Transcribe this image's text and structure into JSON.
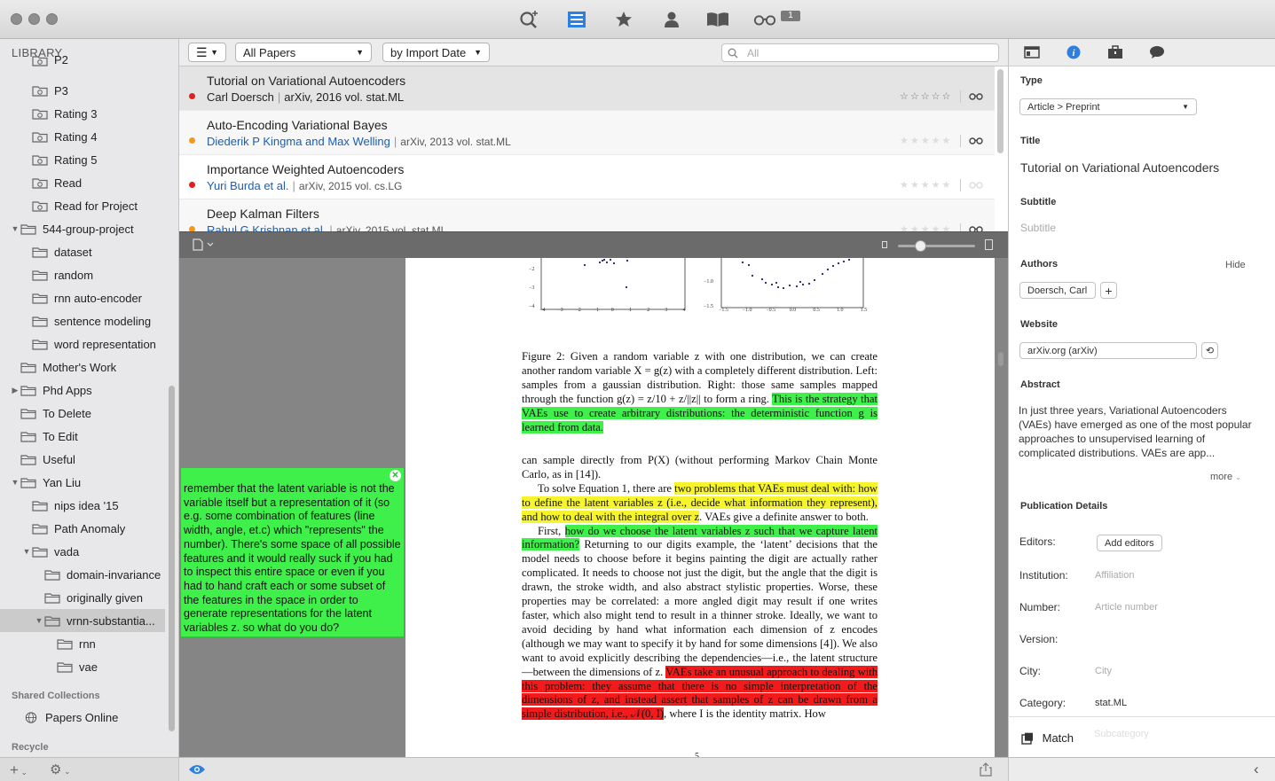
{
  "toolbar": {
    "icons": [
      "add-search-icon",
      "library-icon",
      "star-icon",
      "person-icon",
      "book-icon",
      "glasses-icon"
    ],
    "glasses_badge": "1"
  },
  "sidebar": {
    "header": "LIBRARY",
    "items": [
      {
        "label": "P2",
        "type": "smart",
        "level": 1
      },
      {
        "label": "P3",
        "type": "smart",
        "level": 1
      },
      {
        "label": "Rating 3",
        "type": "smart",
        "level": 1
      },
      {
        "label": "Rating 4",
        "type": "smart",
        "level": 1
      },
      {
        "label": "Rating 5",
        "type": "smart",
        "level": 1
      },
      {
        "label": "Read",
        "type": "smart",
        "level": 1
      },
      {
        "label": "Read for Project",
        "type": "smart",
        "level": 1
      },
      {
        "label": "544-group-project",
        "type": "folder",
        "level": 0,
        "expanded": true
      },
      {
        "label": "dataset",
        "type": "folder",
        "level": 1
      },
      {
        "label": "random",
        "type": "folder",
        "level": 1
      },
      {
        "label": "rnn auto-encoder",
        "type": "folder",
        "level": 1
      },
      {
        "label": "sentence modeling",
        "type": "folder",
        "level": 1
      },
      {
        "label": "word representation",
        "type": "folder",
        "level": 1
      },
      {
        "label": "Mother's Work",
        "type": "folder",
        "level": 0
      },
      {
        "label": "Phd Apps",
        "type": "folder",
        "level": 0,
        "collapsed": true
      },
      {
        "label": "To Delete",
        "type": "folder",
        "level": 0
      },
      {
        "label": "To Edit",
        "type": "folder",
        "level": 0
      },
      {
        "label": "Useful",
        "type": "folder",
        "level": 0
      },
      {
        "label": "Yan Liu",
        "type": "folder",
        "level": 0,
        "expanded": true
      },
      {
        "label": "nips idea '15",
        "type": "folder",
        "level": 1
      },
      {
        "label": "Path Anomaly",
        "type": "folder",
        "level": 1
      },
      {
        "label": "vada",
        "type": "folder",
        "level": 1,
        "expanded": true
      },
      {
        "label": "domain-invariance",
        "type": "folder",
        "level": 2
      },
      {
        "label": "originally given",
        "type": "folder",
        "level": 2
      },
      {
        "label": "vrnn-substantia...",
        "type": "folder",
        "level": 2,
        "expanded": true,
        "selected": true
      },
      {
        "label": "rnn",
        "type": "folder",
        "level": 3
      },
      {
        "label": "vae",
        "type": "folder",
        "level": 3
      }
    ],
    "shared_title": "Shared Collections",
    "shared_items": [
      {
        "label": "Papers Online"
      }
    ],
    "recycle_title": "Recycle"
  },
  "list_toolbar": {
    "filter": "All Papers",
    "sort": "by Import Date",
    "search_placeholder": "All"
  },
  "papers": [
    {
      "title": "Tutorial on Variational Autoencoders",
      "authors": "Carl Doersch",
      "source": "arXiv, 2016 vol. stat.ML",
      "dot": "#e0201e",
      "stars": "☆☆☆☆☆"
    },
    {
      "title": "Auto-Encoding Variational Bayes",
      "authors": "Diederik P Kingma and Max Welling",
      "source": "arXiv, 2013 vol. stat.ML",
      "dot": "#f29a1f",
      "stars": "★★★★★"
    },
    {
      "title": "Importance Weighted Autoencoders",
      "authors": "Yuri Burda et al.",
      "source": "arXiv, 2015 vol. cs.LG",
      "dot": "#e0201e",
      "stars": "★★★★★"
    },
    {
      "title": "Deep Kalman Filters",
      "authors": "Rahul G Krishnan et al.",
      "source": "arXiv, 2015 vol. stat.ML",
      "dot": "#f29a1f",
      "stars": "★★★★★"
    }
  ],
  "note": {
    "text": "remember that the latent variable is not the variable itself but a representation of it (so e.g. some combination of features (line width, angle, et.c) which \"represents\" the number). There's some space of all possible features and it would really suck if you had to inspect this entire space or even if you had to hand craft each or some subset of the features in the space in order to generate representations for the latent variables z. so what do you do?"
  },
  "pdf": {
    "plot_left_yticks": [
      "−2",
      "−3",
      "−4"
    ],
    "plot_left_xticks": [
      "−4",
      "−3",
      "−2",
      "−1",
      "0",
      "1",
      "2",
      "3",
      "4"
    ],
    "plot_right_yticks": [
      "−1.0",
      "−1.5"
    ],
    "plot_right_xticks": [
      "−1.5",
      "−1.0",
      "−0.5",
      "0.0",
      "0.5",
      "1.0",
      "1.5"
    ],
    "caption_plain": "Figure 2: Given a random variable z with one distribution, we can create another random variable X = g(z) with a completely different distribution. Left: samples from a gaussian distribution. Right: those same samples mapped through the function g(z) = z/10 + z/||z|| to form a ring.",
    "caption_hl": "This is the strategy that VAEs use to create arbitrary distributions: the deterministic function g is learned from data.",
    "p1": "can sample directly from P(X) (without performing Markov Chain Monte Carlo, as in [14]).",
    "p2_a": "To solve Equation 1, there are",
    "p2_hl": "two problems that VAEs must deal with: how to define the latent variables z (i.e., decide what information they represent), and how to deal with the integral over z",
    "p2_b": ". VAEs give a definite answer to both.",
    "p3_a": "First,",
    "p3_hl": "how do we choose the latent variables z such that we capture latent information?",
    "p3_b": "Returning to our digits example, the ‘latent’ decisions that the model needs to choose before it begins painting the digit are actually rather complicated. It needs to choose not just the digit, but the angle that the digit is drawn, the stroke width, and also abstract stylistic properties. Worse, these properties may be correlated: a more angled digit may result if one writes faster, which also might tend to result in a thinner stroke. Ideally, we want to avoid deciding by hand what information each dimension of z encodes (although we may want to specify it by hand for some dimensions [4]). We also want to avoid explicitly describing the dependencies—i.e., the latent structure—between the dimensions of z.",
    "p3_hl2": "VAEs take an unusual approach to dealing with this problem: they assume that there is no simple interpretation of the dimensions of z, and instead assert that samples of z can be drawn from a simple distribution, i.e., 𝒩(0, I)",
    "p3_c": ", where I is the identity matrix. How",
    "page_number": "5"
  },
  "inspector": {
    "type_label": "Type",
    "type_value": "Article > Preprint",
    "title_label": "Title",
    "title_value": "Tutorial on Variational Autoencoders",
    "subtitle_label": "Subtitle",
    "subtitle_placeholder": "Subtitle",
    "authors_label": "Authors",
    "authors_hide": "Hide",
    "author_token": "Doersch, Carl",
    "website_label": "Website",
    "website_value": "arXiv.org (arXiv)",
    "abstract_label": "Abstract",
    "abstract_text": "In just three years, Variational Autoencoders (VAEs) have emerged as one of the most popular approaches to unsupervised learning of complicated distributions. VAEs are app...",
    "more": "more",
    "pub_details_label": "Publication Details",
    "editors_label": "Editors:",
    "add_editors": "Add editors",
    "institution_label": "Institution:",
    "institution_placeholder": "Affiliation",
    "number_label": "Number:",
    "number_placeholder": "Article number",
    "version_label": "Version:",
    "city_label": "City:",
    "city_placeholder": "City",
    "category_label": "Category:",
    "category_value": "stat.ML",
    "subcategory_placeholder": "Subcategory",
    "match_label": "Match"
  }
}
